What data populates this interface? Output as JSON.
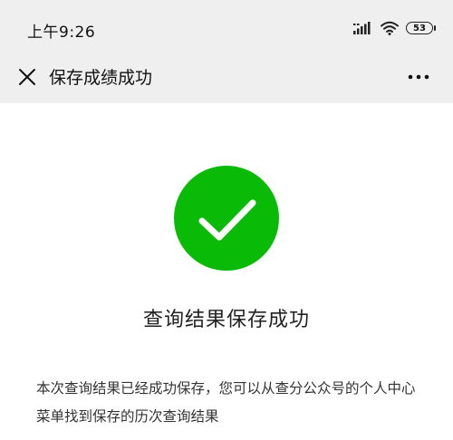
{
  "status_bar": {
    "time": "上午9:26",
    "battery_level": "53",
    "icons": [
      "signal-icon",
      "wifi-icon",
      "battery-icon"
    ]
  },
  "nav": {
    "title": "保存成绩成功",
    "close_icon": "close-icon",
    "more_icon": "more-icon"
  },
  "result": {
    "icon": "success-check-icon",
    "title": "查询结果保存成功",
    "description": "本次查询结果已经成功保存，您可以从查分公众号的个人中心菜单找到保存的历次查询结果"
  },
  "colors": {
    "success_green": "#09BB07",
    "bar_background": "#EFEFEF",
    "text_primary": "#222222"
  }
}
